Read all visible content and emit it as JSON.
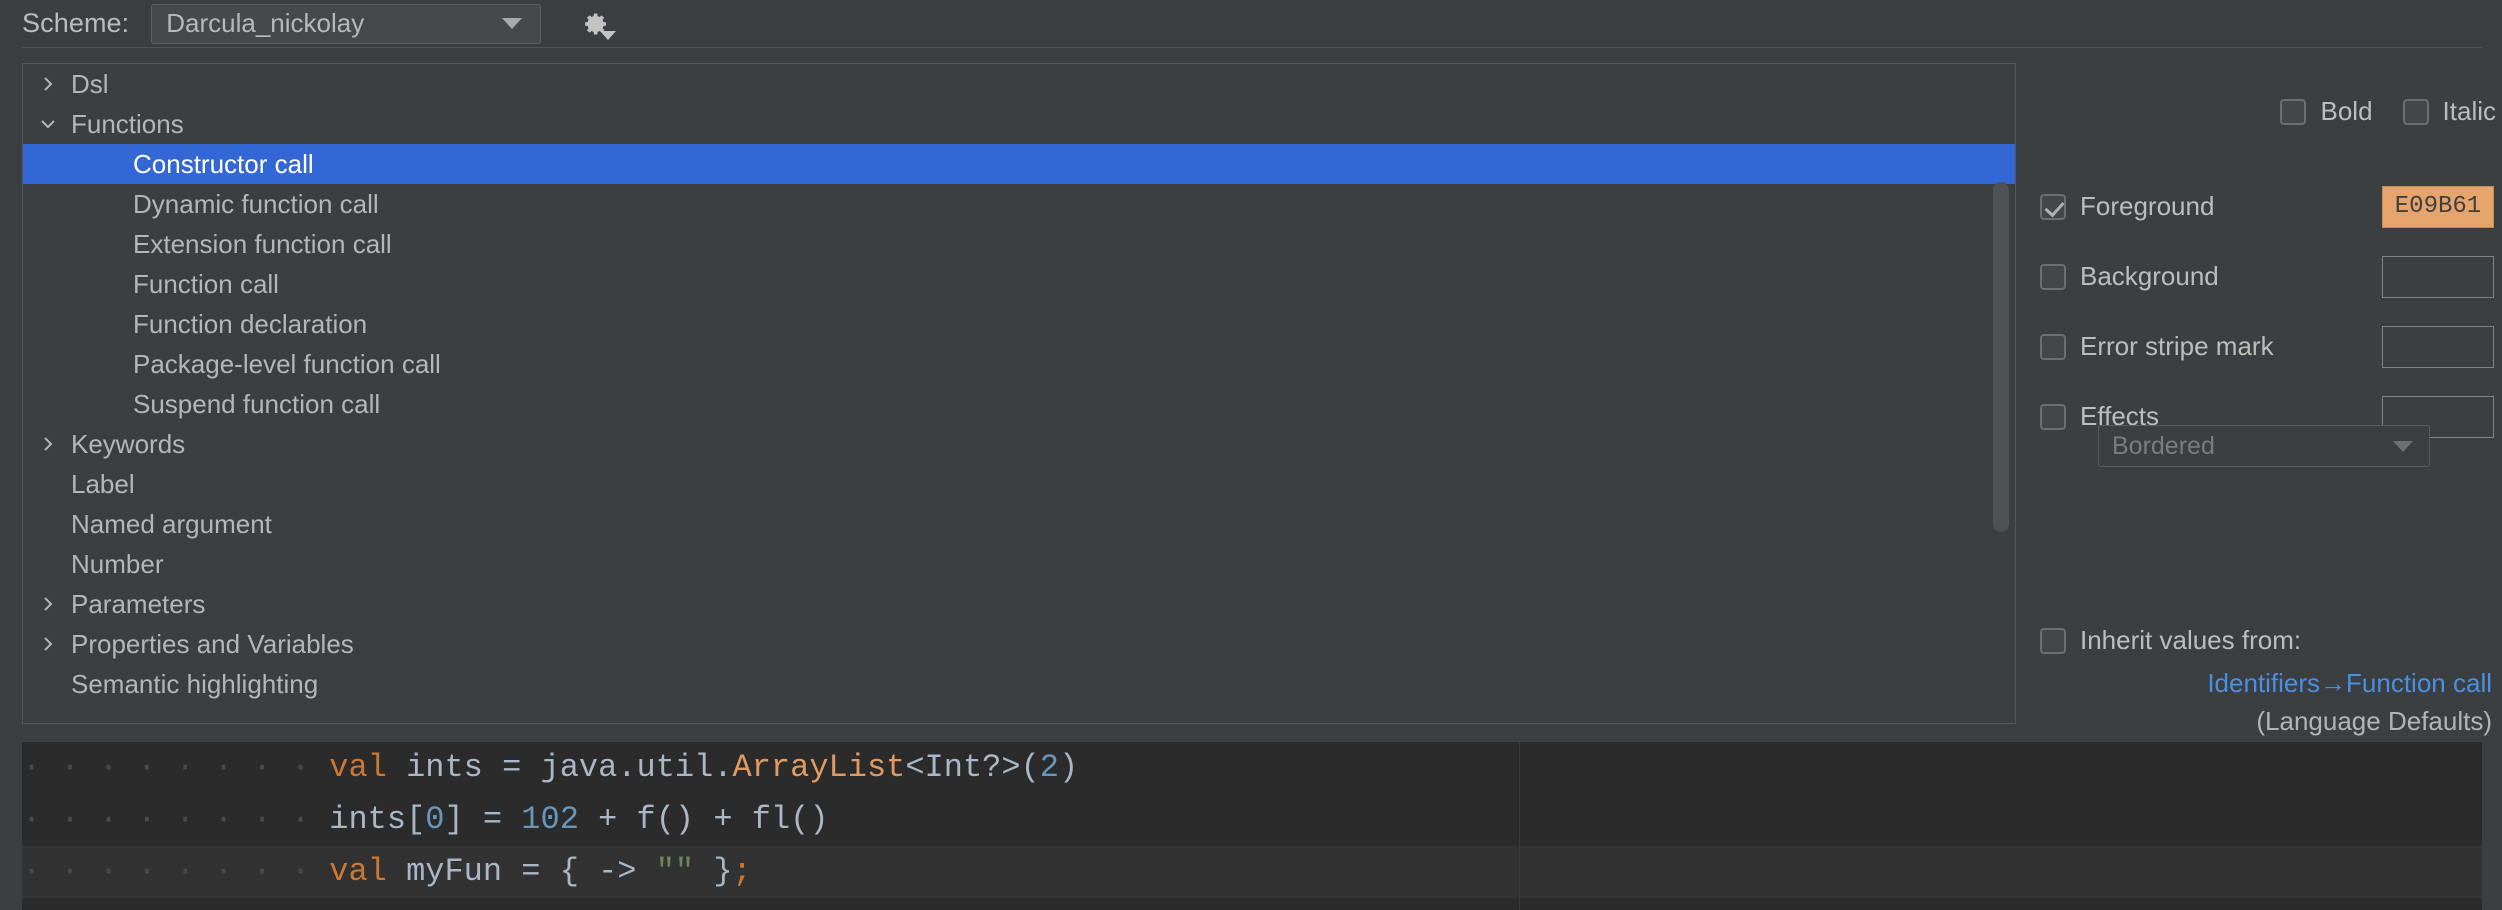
{
  "scheme_bar": {
    "label": "Scheme:",
    "selected_scheme": "Darcula_nickolay",
    "dropdown_icon": "chevron-down-icon",
    "gear_icon": "gear-icon"
  },
  "tree": {
    "items": [
      {
        "label": "Dsl",
        "depth": 0,
        "expandable": true,
        "expanded": false,
        "selected": false
      },
      {
        "label": "Functions",
        "depth": 0,
        "expandable": true,
        "expanded": true,
        "selected": false
      },
      {
        "label": "Constructor call",
        "depth": 1,
        "expandable": false,
        "expanded": false,
        "selected": true
      },
      {
        "label": "Dynamic function call",
        "depth": 1,
        "expandable": false,
        "expanded": false,
        "selected": false
      },
      {
        "label": "Extension function call",
        "depth": 1,
        "expandable": false,
        "expanded": false,
        "selected": false
      },
      {
        "label": "Function call",
        "depth": 1,
        "expandable": false,
        "expanded": false,
        "selected": false
      },
      {
        "label": "Function declaration",
        "depth": 1,
        "expandable": false,
        "expanded": false,
        "selected": false
      },
      {
        "label": "Package-level function call",
        "depth": 1,
        "expandable": false,
        "expanded": false,
        "selected": false
      },
      {
        "label": "Suspend function call",
        "depth": 1,
        "expandable": false,
        "expanded": false,
        "selected": false
      },
      {
        "label": "Keywords",
        "depth": 0,
        "expandable": true,
        "expanded": false,
        "selected": false
      },
      {
        "label": "Label",
        "depth": 0,
        "expandable": false,
        "expanded": false,
        "selected": false
      },
      {
        "label": "Named argument",
        "depth": 0,
        "expandable": false,
        "expanded": false,
        "selected": false
      },
      {
        "label": "Number",
        "depth": 0,
        "expandable": false,
        "expanded": false,
        "selected": false
      },
      {
        "label": "Parameters",
        "depth": 0,
        "expandable": true,
        "expanded": false,
        "selected": false
      },
      {
        "label": "Properties and Variables",
        "depth": 0,
        "expandable": true,
        "expanded": false,
        "selected": false
      },
      {
        "label": "Semantic highlighting",
        "depth": 0,
        "expandable": false,
        "expanded": false,
        "selected": false
      }
    ],
    "selection_color": "#3367d6"
  },
  "attributes": {
    "bold": {
      "label": "Bold",
      "checked": false
    },
    "italic": {
      "label": "Italic",
      "checked": false
    },
    "foreground": {
      "label": "Foreground",
      "checked": true,
      "value": "E09B61",
      "swatch_color": "#e6a46d"
    },
    "background": {
      "label": "Background",
      "checked": false,
      "value": ""
    },
    "error_stripe_mark": {
      "label": "Error stripe mark",
      "checked": false,
      "value": ""
    },
    "effects": {
      "label": "Effects",
      "checked": false,
      "value": ""
    },
    "effects_type": {
      "selected": "Bordered",
      "enabled": false
    },
    "inherit": {
      "label": "Inherit values from:",
      "checked": false,
      "link": "Identifiers→Function call",
      "sublabel": "(Language Defaults)",
      "link_color": "#4a90e2"
    }
  },
  "code_preview": {
    "lines": [
      {
        "alt": false,
        "tokens": [
          {
            "t": "· · · · · · · · ",
            "c": "ind"
          },
          {
            "t": "val",
            "c": "kw"
          },
          {
            "t": " ints = java.util.",
            "c": "plain"
          },
          {
            "t": "ArrayList",
            "c": "ctor"
          },
          {
            "t": "<Int?>(",
            "c": "plain"
          },
          {
            "t": "2",
            "c": "num"
          },
          {
            "t": ")",
            "c": "plain"
          }
        ]
      },
      {
        "alt": false,
        "tokens": [
          {
            "t": "· · · · · · · · ",
            "c": "ind"
          },
          {
            "t": "ints[",
            "c": "plain"
          },
          {
            "t": "0",
            "c": "num"
          },
          {
            "t": "] = ",
            "c": "plain"
          },
          {
            "t": "102",
            "c": "num"
          },
          {
            "t": " + f() + fl()",
            "c": "plain"
          }
        ]
      },
      {
        "alt": true,
        "tokens": [
          {
            "t": "· · · · · · · · ",
            "c": "ind"
          },
          {
            "t": "val",
            "c": "kw"
          },
          {
            "t": " myFun = { -> ",
            "c": "plain"
          },
          {
            "t": "\"\"",
            "c": "str"
          },
          {
            "t": " }",
            "c": "plain"
          },
          {
            "t": ";",
            "c": "kw"
          }
        ]
      }
    ]
  }
}
